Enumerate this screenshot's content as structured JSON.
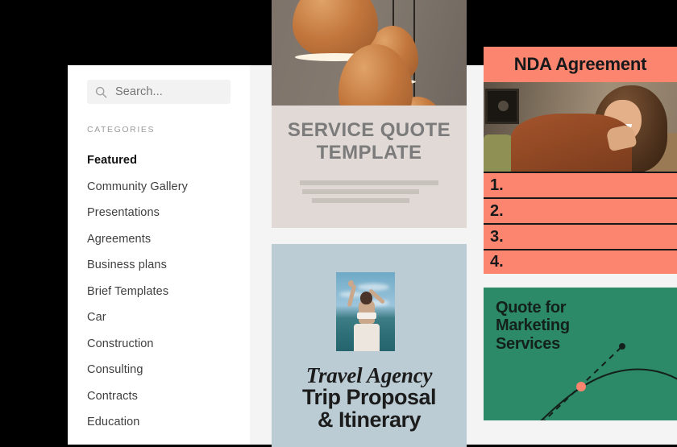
{
  "sidebar": {
    "search": {
      "placeholder": "Search...",
      "value": "",
      "icon": "search-icon"
    },
    "categories_heading": "CATEGORIES",
    "items": [
      {
        "label": "Featured",
        "active": true
      },
      {
        "label": "Community Gallery",
        "active": false
      },
      {
        "label": "Presentations",
        "active": false
      },
      {
        "label": "Agreements",
        "active": false
      },
      {
        "label": "Business plans",
        "active": false
      },
      {
        "label": "Brief Templates",
        "active": false
      },
      {
        "label": "Car",
        "active": false
      },
      {
        "label": "Construction",
        "active": false
      },
      {
        "label": "Consulting",
        "active": false
      },
      {
        "label": "Contracts",
        "active": false
      },
      {
        "label": "Education",
        "active": false
      }
    ]
  },
  "cards": {
    "service_quote": {
      "title_line1": "SERVICE QUOTE",
      "title_line2": "TEMPLATE",
      "image_alt": "copper-pendant-lamps-photo",
      "background": "#e0d9d5",
      "title_color": "#7b7b7b"
    },
    "travel_agency": {
      "script_title": "Travel Agency",
      "sub_line1": "Trip Proposal",
      "sub_line2": "& Itinerary",
      "image_alt": "woman-raising-arms-at-beach-photo",
      "background": "#bbccd4"
    },
    "nda_agreement": {
      "title": "NDA Agreement",
      "image_alt": "smiling-woman-in-brown-sweater-photo",
      "background": "#fc8570",
      "rows": [
        "1.",
        "2.",
        "3.",
        "4."
      ]
    },
    "marketing_quote": {
      "title_line1": "Quote for",
      "title_line2": "Marketing",
      "title_line3": "Services",
      "background": "#2c8a69",
      "accent": "#fc8570",
      "graphic": "curve-with-dashed-trend-line"
    }
  },
  "colors": {
    "page_background": "#f4f4f4",
    "sidebar_background": "#ffffff",
    "window_chrome": "#000000",
    "accent_orange": "#fc8570",
    "accent_green": "#2c8a69"
  }
}
